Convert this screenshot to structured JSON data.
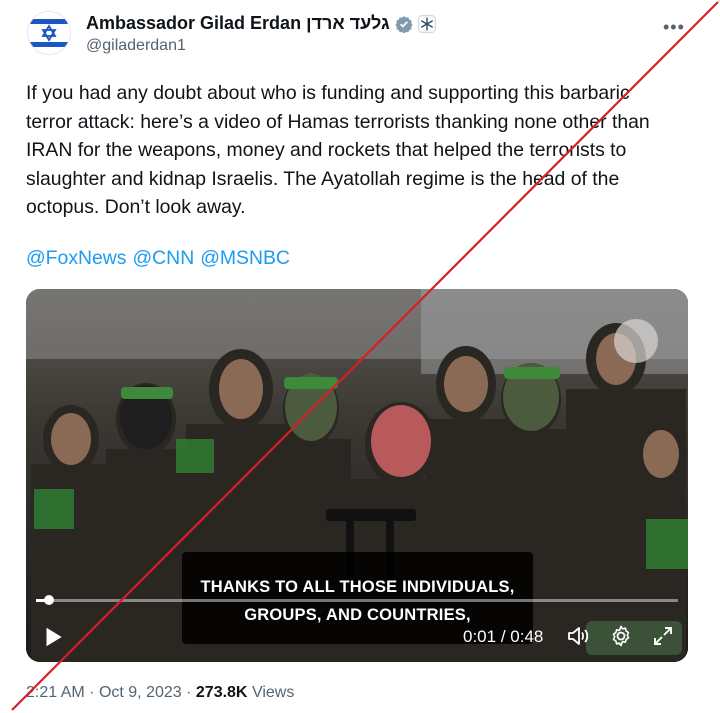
{
  "author": {
    "display_name": "Ambassador Gilad Erdan גלעד ארדן",
    "handle": "@giladerdan1",
    "verified_badge_color": "#829aab",
    "avatar_icon": "israel-flag-icon",
    "affiliate_icon": "snowflake-icon"
  },
  "more_icon": "more-options-icon",
  "tweet": {
    "lines": [
      "If you had any doubt about who is funding and supporting this barbaric",
      "terror attack: here’s a video of Hamas terrorists thanking none other than",
      "IRAN for the weapons, money and rockets that helped the terrorists to",
      "slaughter and kidnap Israelis. The Ayatollah regime is the head of the",
      "octopus. Don’t look away."
    ],
    "mentions": [
      "@FoxNews",
      "@CNN",
      "@MSNBC"
    ]
  },
  "video": {
    "caption_lines": [
      "THANKS TO ALL THOSE INDIVIDUALS,",
      "GROUPS, AND COUNTRIES,"
    ],
    "time_current": "0:01",
    "time_separator": "/",
    "time_total": "0:48",
    "progress_fraction": 0.02,
    "controls": [
      "play-icon",
      "volume-icon",
      "settings-gear-icon",
      "fullscreen-icon"
    ]
  },
  "footer": {
    "time": "2:21 AM",
    "separator": "·",
    "date": "Oct 9, 2023",
    "views_count": "273.8K",
    "views_label": "Views"
  },
  "colors": {
    "link": "#1d9bf0",
    "secondary_text": "#536471",
    "primary_text": "#0f1419",
    "strike_line": "#d61f26"
  }
}
